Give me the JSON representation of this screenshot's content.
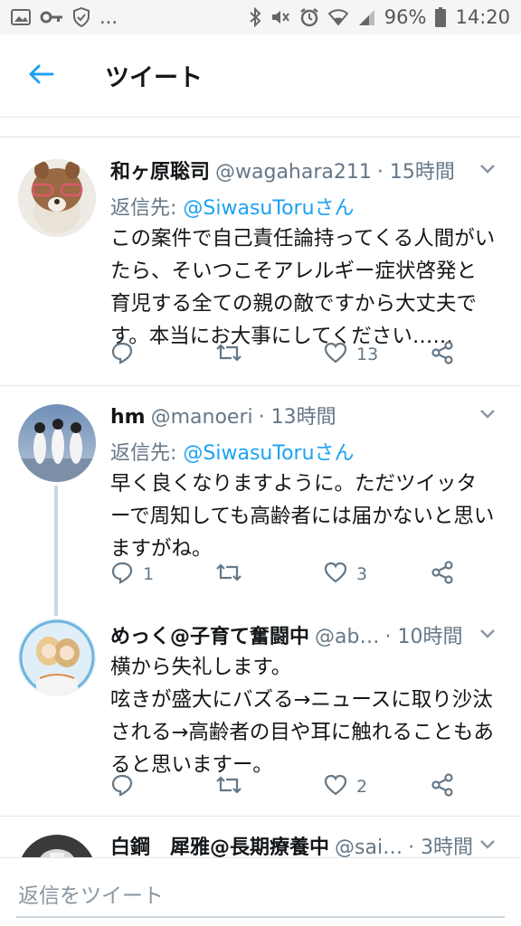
{
  "status_bar": {
    "dots": "...",
    "battery": "96%",
    "time": "14:20"
  },
  "header": {
    "title": "ツイート",
    "back_icon": "arrow-left-icon"
  },
  "tweets": [
    {
      "display_name": "和ヶ原聡司",
      "handle": "@wagahara211",
      "time": "· 15時間",
      "reply_prefix": "返信先: ",
      "reply_mention": "@SiwasuToruさん",
      "text": "この案件で自己責任論持ってくる人間がいたら、そいつこそアレルギー症状啓発と育児する全ての親の敵ですから大丈夫です。本当にお大事にしてください……",
      "replies": "",
      "retweets": "",
      "likes": "13"
    },
    {
      "display_name": "hm",
      "handle": "@manoeri",
      "time": "· 13時間",
      "reply_prefix": "返信先: ",
      "reply_mention": "@SiwasuToruさん",
      "text": "早く良くなりますように。ただツイッターで周知しても高齢者には届かないと思いますがね。",
      "replies": "1",
      "retweets": "",
      "likes": "3"
    },
    {
      "display_name": "めっく@子育て奮闘中",
      "handle": "@ab…",
      "time": "· 10時間",
      "text": "横から失礼します。\n呟きが盛大にバズる→ニュースに取り沙汰される→高齢者の目や耳に触れることもあると思いますー。",
      "replies": "",
      "retweets": "",
      "likes": "2"
    },
    {
      "display_name": "白鋼　犀雅@長期療養中",
      "handle": "@sai…",
      "time": "· 3時間"
    }
  ],
  "composer": {
    "placeholder": "返信をツイート"
  },
  "colors": {
    "accent": "#1da1f2",
    "muted": "#657786",
    "divider": "#e1e8ed"
  }
}
